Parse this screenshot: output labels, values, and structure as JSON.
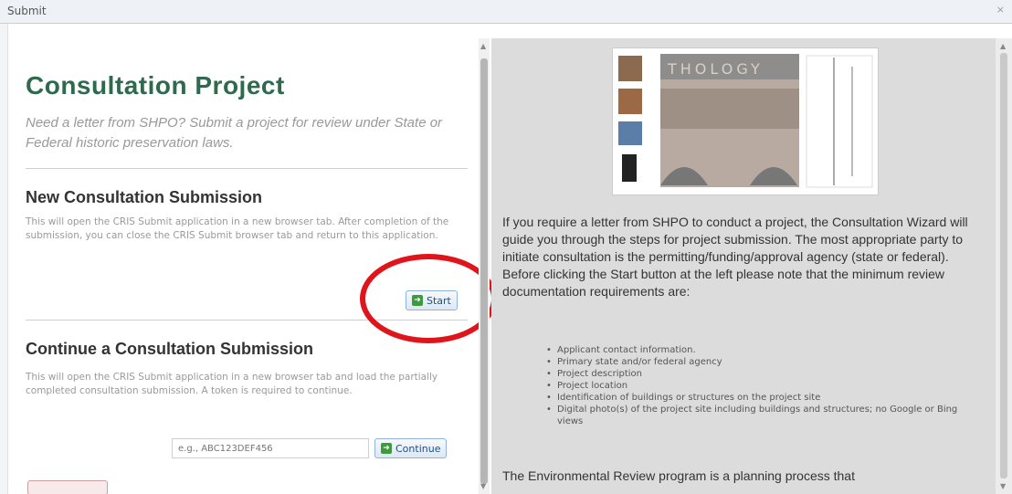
{
  "window": {
    "title": "Submit",
    "close": "×"
  },
  "left": {
    "title": "Consultation Project",
    "subtitle": "Need a letter from SHPO? Submit a project for review under State or Federal historic preservation laws.",
    "new_section": {
      "heading": "New Consultation Submission",
      "body": "This will open the CRIS Submit application in a new browser tab. After completion of the submission, you can close the CRIS Submit browser tab and return to this application.",
      "button": "Start"
    },
    "continue_section": {
      "heading": "Continue a Consultation Submission",
      "body": "This will open the CRIS Submit application in a new browser tab and load the partially completed consultation submission. A token is required to continue.",
      "token_placeholder": "e.g., ABC123DEF456",
      "button": "Continue"
    }
  },
  "right": {
    "image_banner_text": "THOLOGY",
    "paragraph1": "If you require a letter from SHPO to conduct a project, the Consultation Wizard will guide you through the steps for project submission. The most appropriate party to initiate consultation is the permitting/funding/approval agency (state or federal). Before clicking the Start button at the left please note that the minimum review documentation requirements are:",
    "requirements": [
      "Applicant contact information.",
      "Primary state and/or federal agency",
      "Project description",
      "Project location",
      "Identification of buildings or structures on the project site",
      "Digital photo(s) of the project site including buildings and structures; no Google or Bing views"
    ],
    "paragraph2": "The Environmental Review program is a planning process that"
  },
  "colors": {
    "title_green": "#2f6a4f",
    "annotation_red": "#e0141b",
    "right_panel_bg": "#dcdcdc"
  }
}
